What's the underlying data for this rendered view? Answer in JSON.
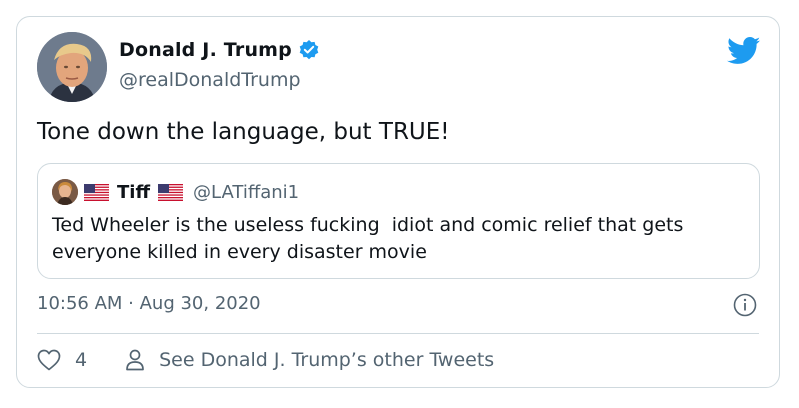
{
  "tweet": {
    "author": {
      "name": "Donald J. Trump",
      "handle": "@realDonaldTrump",
      "verified": true,
      "avatar_icon": "avatar-photo"
    },
    "text": "Tone down the language, but TRUE!",
    "timestamp": "10:56 AM · Aug 30, 2020",
    "likes": "4",
    "other_tweets_link": "See Donald J. Trump’s other Tweets"
  },
  "quoted_tweet": {
    "name": "Tiff",
    "handle": "@LATiffani1",
    "text": "Ted Wheeler is the useless fucking  idiot and comic relief that gets everyone killed in every disaster movie"
  },
  "colors": {
    "accent": "#1d9bf0",
    "secondary_text": "#536471",
    "border": "#cfd9de"
  },
  "icons": [
    "twitter-bird-icon",
    "verified-badge-icon",
    "us-flag-icon",
    "info-icon",
    "heart-icon",
    "person-icon"
  ]
}
